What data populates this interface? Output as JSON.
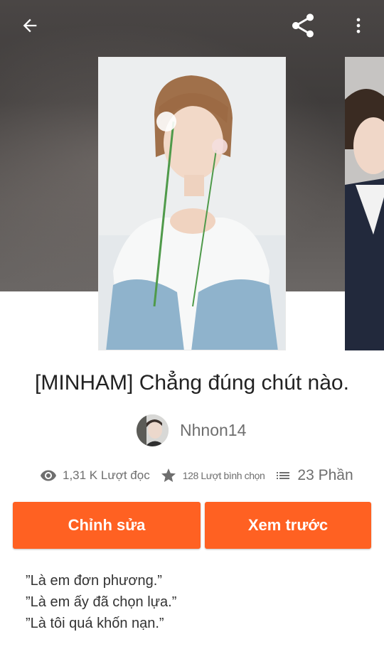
{
  "story": {
    "title": "[MINHAM] Chẳng đúng chút nào.",
    "author": "Nhnon14",
    "stats": {
      "reads": "1,31 K Lượt đọc",
      "votes": "128 Lượt bình chọn",
      "parts": "23 Phần"
    },
    "description": [
      "”Là em đơn phương.”",
      "”Là em ấy đã chọn lựa.”",
      "”Là tôi quá khốn nạn.”"
    ]
  },
  "actions": {
    "edit_label": "Chỉnh sửa",
    "preview_label": "Xem trước"
  },
  "icons": {
    "back": "arrow-back-icon",
    "share": "share-icon",
    "more": "more-vertical-icon",
    "reads": "eye-icon",
    "votes": "star-icon",
    "parts": "list-icon"
  },
  "colors": {
    "accent": "#ff6122",
    "text_primary": "#222222",
    "text_secondary": "#6e6e6e"
  }
}
